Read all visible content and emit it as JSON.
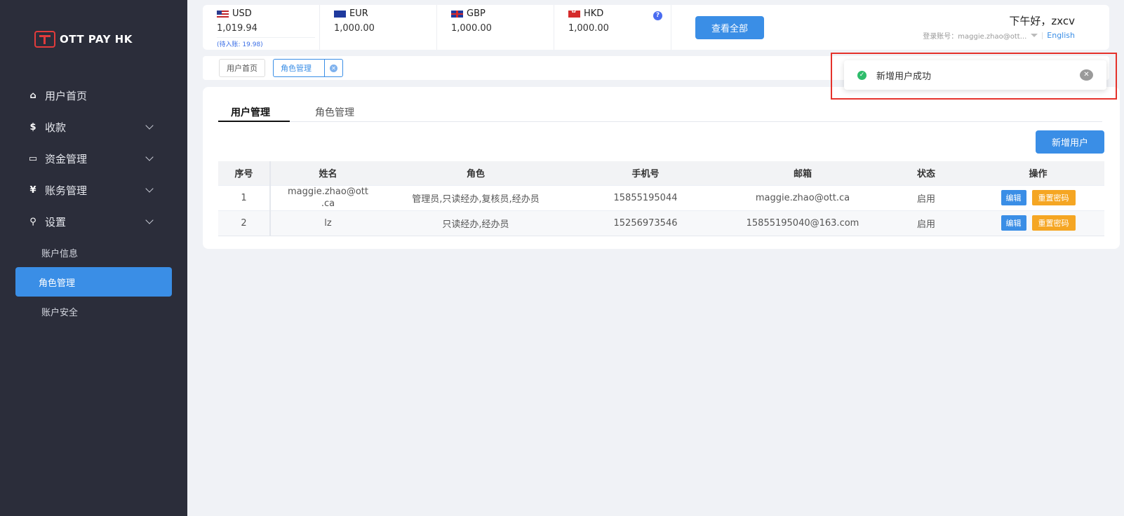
{
  "logo": {
    "text": "OTT PAY HK"
  },
  "sidebar": {
    "items": [
      {
        "label": "用户首页",
        "icon": "home-icon"
      },
      {
        "label": "收款",
        "icon": "dollar-icon"
      },
      {
        "label": "资金管理",
        "icon": "card-icon"
      },
      {
        "label": "账务管理",
        "icon": "yen-icon"
      },
      {
        "label": "设置",
        "icon": "search-icon"
      }
    ],
    "sub_items": [
      {
        "label": "账户信息"
      },
      {
        "label": "角色管理"
      },
      {
        "label": "账户安全"
      }
    ]
  },
  "header": {
    "currencies": [
      {
        "code": "USD",
        "amount": "1,019.94",
        "pending": "(待入账: 19.98)"
      },
      {
        "code": "EUR",
        "amount": "1,000.00"
      },
      {
        "code": "GBP",
        "amount": "1,000.00"
      },
      {
        "code": "HKD",
        "amount": "1,000.00"
      }
    ],
    "view_all": "查看全部",
    "greeting": "下午好，zxcv",
    "account_label": "登录账号：maggie.zhao@ott...",
    "language": "English"
  },
  "tags": [
    {
      "label": "用户首页"
    },
    {
      "label": "角色管理"
    }
  ],
  "main": {
    "tabs": [
      {
        "label": "用户管理"
      },
      {
        "label": "角色管理"
      }
    ],
    "add_user": "新增用户",
    "columns": [
      "序号",
      "姓名",
      "角色",
      "手机号",
      "邮箱",
      "状态",
      "操作"
    ],
    "rows": [
      {
        "idx": "1",
        "name_line1": "maggie.zhao@ott",
        "name_line2": ".ca",
        "role": "管理员,只读经办,复核员,经办员",
        "phone": "15855195044",
        "email": "maggie.zhao@ott.ca",
        "status": "启用"
      },
      {
        "idx": "2",
        "name_line1": "lz",
        "name_line2": "",
        "role": "只读经办,经办员",
        "phone": "15256973546",
        "email": "15855195040@163.com",
        "status": "启用"
      }
    ],
    "edit_label": "编辑",
    "reset_label": "重置密码"
  },
  "notification": {
    "message": "新增用户成功"
  }
}
